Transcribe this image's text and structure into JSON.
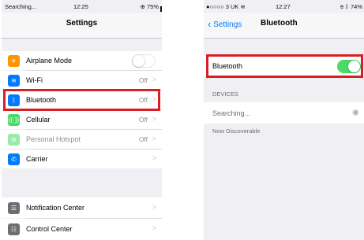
{
  "left": {
    "status": {
      "carrier": "Searching...",
      "time": "12:25",
      "battery": "75%"
    },
    "title": "Settings",
    "items": [
      {
        "label": "Airplane Mode",
        "icon": "airplane-icon",
        "color": "#ff9500"
      },
      {
        "label": "Wi-Fi",
        "value": "Off",
        "icon": "wifi-icon",
        "color": "#007aff"
      },
      {
        "label": "Bluetooth",
        "value": "Off",
        "icon": "bluetooth-icon",
        "color": "#007aff"
      },
      {
        "label": "Cellular",
        "value": "Off",
        "icon": "cellular-icon",
        "color": "#4cd964"
      },
      {
        "label": "Personal Hotspot",
        "value": "Off",
        "icon": "hotspot-icon",
        "color": "#4cd964"
      },
      {
        "label": "Carrier",
        "icon": "phone-icon",
        "color": "#007aff"
      },
      {
        "label": "Notification Center",
        "icon": "notification-icon",
        "color": "#6d6d72"
      },
      {
        "label": "Control Center",
        "icon": "control-center-icon",
        "color": "#6d6d72"
      }
    ]
  },
  "right": {
    "status": {
      "carrier": "●○○○○ 3 UK",
      "time": "12:27",
      "battery": "74%"
    },
    "back_label": "Settings",
    "title": "Bluetooth",
    "bluetooth_label": "Bluetooth",
    "bluetooth_on": true,
    "devices_header": "DEVICES",
    "searching_label": "Searching...",
    "discoverable_text": "Now Discoverable"
  },
  "colors": {
    "highlight": "#d91f26",
    "toggle_on": "#4cd964",
    "accent": "#007aff"
  }
}
